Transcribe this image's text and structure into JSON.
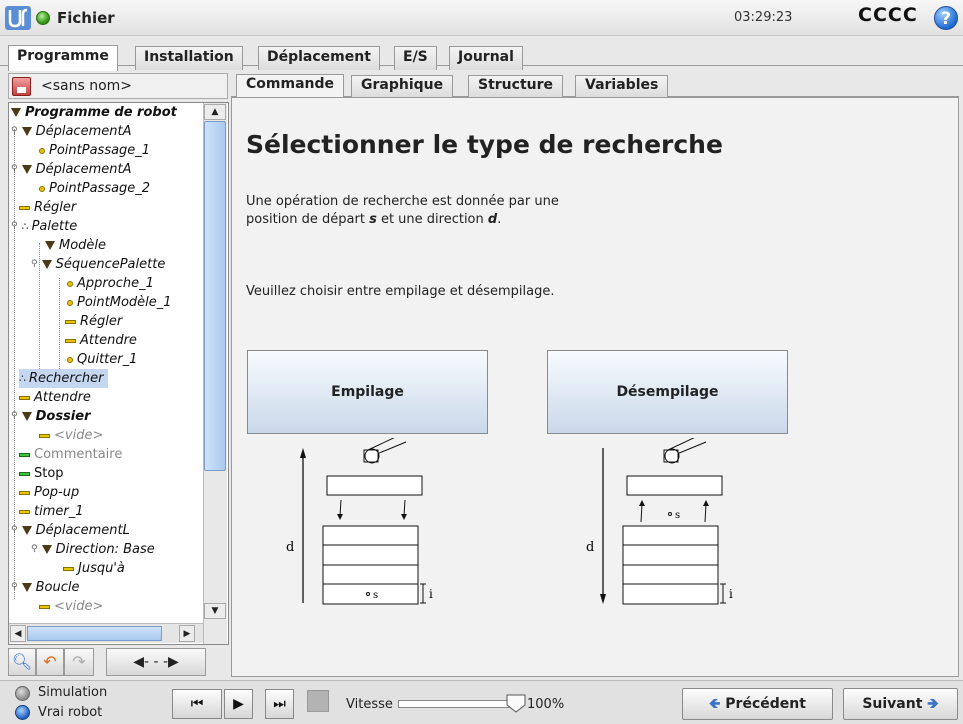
{
  "header": {
    "menu_label": "Fichier",
    "clock": "03:29:23",
    "robot_name": "CCCC",
    "help_glyph": "?"
  },
  "main_tabs": [
    {
      "label": "Programme"
    },
    {
      "label": "Installation"
    },
    {
      "label": "Déplacement"
    },
    {
      "label": "E/S"
    },
    {
      "label": "Journal"
    }
  ],
  "file": {
    "name": "<sans nom>"
  },
  "tree": [
    {
      "label": "Programme de robot"
    },
    {
      "label": "DéplacementA"
    },
    {
      "label": "PointPassage_1"
    },
    {
      "label": "DéplacementA"
    },
    {
      "label": "PointPassage_2"
    },
    {
      "label": "Régler"
    },
    {
      "label": "Palette"
    },
    {
      "label": "Modèle"
    },
    {
      "label": "SéquencePalette"
    },
    {
      "label": "Approche_1"
    },
    {
      "label": "PointModèle_1"
    },
    {
      "label": "Régler"
    },
    {
      "label": "Attendre"
    },
    {
      "label": "Quitter_1"
    },
    {
      "label": "Rechercher"
    },
    {
      "label": "Attendre"
    },
    {
      "label": "Dossier"
    },
    {
      "label": "<vide>"
    },
    {
      "label": "Commentaire"
    },
    {
      "label": "Stop"
    },
    {
      "label": "Pop-up"
    },
    {
      "label": "timer_1"
    },
    {
      "label": "DéplacementL"
    },
    {
      "label": "Direction: Base"
    },
    {
      "label": "Jusqu'à"
    },
    {
      "label": "Boucle"
    },
    {
      "label": "<vide>"
    }
  ],
  "sub_tabs": [
    {
      "label": "Commande"
    },
    {
      "label": "Graphique"
    },
    {
      "label": "Structure"
    },
    {
      "label": "Variables"
    }
  ],
  "panel": {
    "title": "Sélectionner le type de recherche",
    "desc_line1": "Une opération de recherche est donnée par une",
    "desc_line2_prefix": "position de départ ",
    "desc_s": "s",
    "desc_line2_mid": " et une direction ",
    "desc_d": "d",
    "desc_line2_end": ".",
    "desc_line3": "Veuillez choisir entre empilage et désempilage.",
    "btn_stack": "Empilage",
    "btn_unstack": "Désempilage",
    "diagram_d": "d",
    "diagram_s": "s",
    "diagram_i": "i"
  },
  "bottom": {
    "sim_label": "Simulation",
    "real_label": "Vrai robot",
    "speed_label": "Vitesse",
    "speed_value": "100%",
    "prev_label": "Précédent",
    "next_label": "Suivant"
  },
  "colors": {
    "accent_blue": "#3a73c8",
    "selection": "#c5d7f0",
    "button_gradient_end": "#c9d8ea"
  }
}
